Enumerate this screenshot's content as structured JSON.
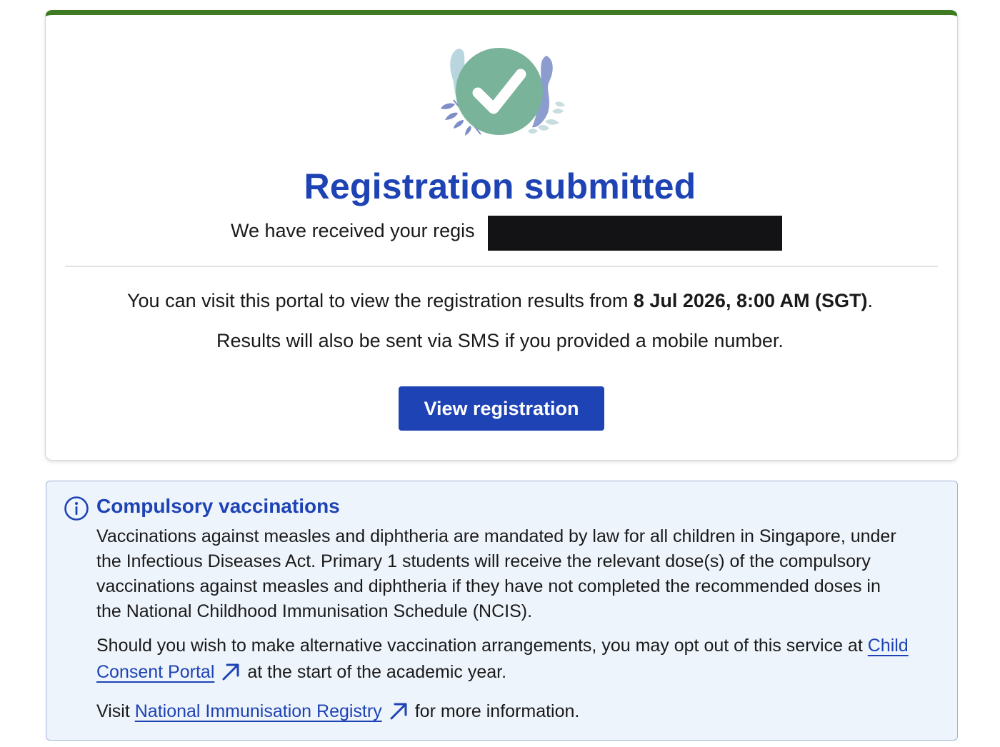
{
  "confirmation": {
    "title": "Registration submitted",
    "received_text": "We have received your regis",
    "visit_prefix": "You can visit this portal to view the registration results from ",
    "results_date": "8 Jul 2026, 8:00 AM (SGT)",
    "visit_suffix": ".",
    "sms_text": "Results will also be sent via SMS if you provided a mobile number.",
    "view_button_label": "View registration"
  },
  "info": {
    "title": "Compulsory vaccinations",
    "paragraph1_lines": [
      "Vaccinations against measles and diphtheria are mandated by law for all children in Singapore, under",
      "the Infectious Diseases Act. Primary 1 students will receive the relevant dose(s) of the compulsory",
      "vaccinations against measles and diphtheria if they have not completed the recommended doses in",
      "the National Childhood Immunisation Schedule (NCIS)."
    ],
    "paragraph2_prefix": "Should you wish to make alternative vaccination arrangements, you may opt out of this service at ",
    "consent_link_line1": "Child",
    "consent_link_line2": "Consent Portal",
    "paragraph2_suffix": "at the start of the academic year.",
    "paragraph3_prefix": "Visit ",
    "registry_link": "National Immunisation Registry",
    "paragraph3_suffix": "for more information."
  },
  "icons": {
    "success": "check-circle-icon",
    "info": "info-circle-icon",
    "external_link": "arrow-up-right-icon"
  },
  "colors": {
    "accent_green": "#3d7a22",
    "primary_blue": "#1e43b4",
    "check_green": "#78b39a",
    "info_background": "#eef4fc"
  }
}
